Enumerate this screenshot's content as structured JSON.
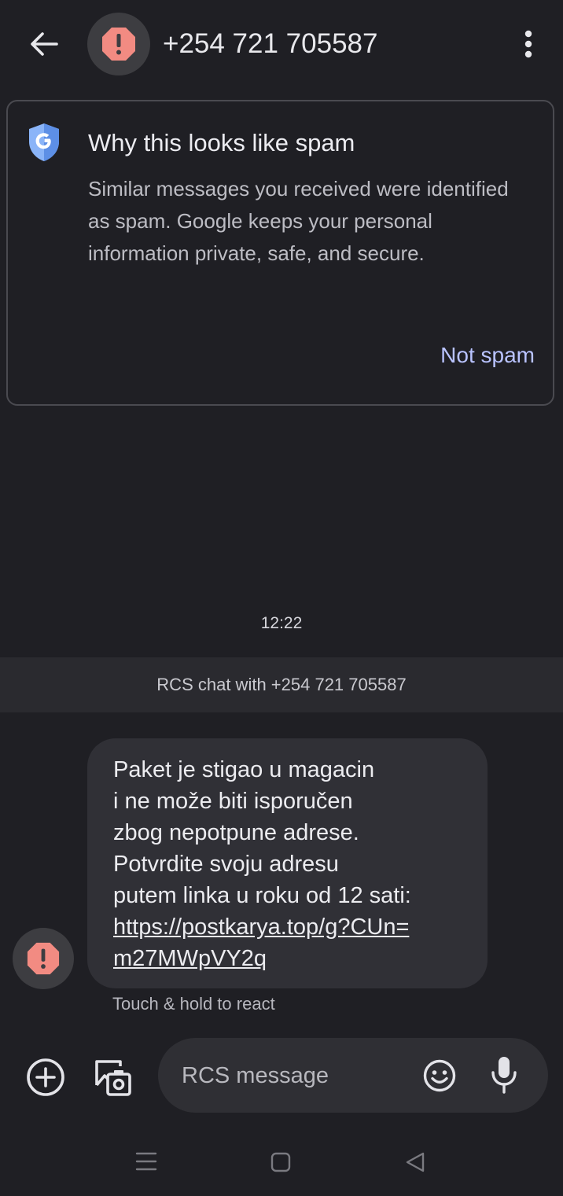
{
  "header": {
    "title": "+254 721 705587",
    "icons": {
      "back": "arrow-left-icon",
      "avatar": "warning-icon",
      "more": "more-vert-icon"
    }
  },
  "spam_card": {
    "title": "Why this looks like spam",
    "body": "Similar messages you received were identified as spam. Google keeps your personal information private, safe, and secure.",
    "action_label": "Not spam",
    "icon": "google-shield-icon"
  },
  "conversation": {
    "timestamp": "12:22",
    "rcs_banner": "RCS chat with +254 721 705587",
    "messages": [
      {
        "text": "Paket je stigao u magacin\ni ne može biti isporučen\nzbog nepotpune adrese.\nPotvrdite svoju adresu\nputem linka u roku od 12 sati:",
        "link": "https://postkarya.top/g?CUn=\nm27MWpVY2q"
      }
    ],
    "react_hint": "Touch & hold to react"
  },
  "compose": {
    "placeholder": "RCS message",
    "icons": [
      "add-circle-icon",
      "gallery-camera-icon",
      "emoji-icon",
      "mic-icon"
    ]
  },
  "nav": {
    "icons": [
      "recents-icon",
      "home-icon",
      "back-icon"
    ]
  },
  "colors": {
    "background": "#1f1f24",
    "accent": "#b9c3ff",
    "warning": "#f28b82",
    "bubble": "#303036",
    "banner": "#2a2a2f"
  }
}
